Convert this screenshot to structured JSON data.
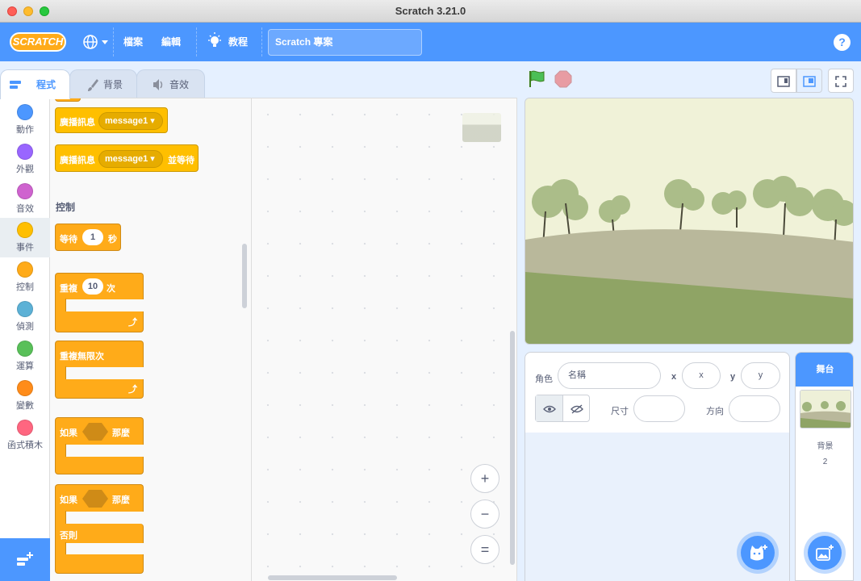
{
  "window": {
    "title": "Scratch 3.21.0"
  },
  "menu": {
    "logo": "SCRATCH",
    "file": "檔案",
    "edit": "編輯",
    "tutorials": "教程",
    "project_title": "Scratch 專案",
    "help": "?"
  },
  "tabs": [
    {
      "label": "程式"
    },
    {
      "label": "背景"
    },
    {
      "label": "音效"
    }
  ],
  "categories": [
    {
      "label": "動作",
      "color": "#4c97ff"
    },
    {
      "label": "外觀",
      "color": "#9966ff"
    },
    {
      "label": "音效",
      "color": "#cf63cf"
    },
    {
      "label": "事件",
      "color": "#ffbf00"
    },
    {
      "label": "控制",
      "color": "#ffab19"
    },
    {
      "label": "偵測",
      "color": "#5cb1d6"
    },
    {
      "label": "運算",
      "color": "#59c059"
    },
    {
      "label": "變數",
      "color": "#ff8c1a"
    },
    {
      "label": "函式積木",
      "color": "#ff6680"
    }
  ],
  "blocks": {
    "broadcast": {
      "label": "廣播訊息",
      "message": "message1"
    },
    "broadcast_wait": {
      "label": "廣播訊息",
      "message": "message1",
      "suffix": "並等待"
    },
    "section_control": "控制",
    "wait": {
      "label": "等待",
      "value": "1",
      "unit": "秒"
    },
    "repeat": {
      "label": "重複",
      "value": "10",
      "unit": "次"
    },
    "forever": {
      "label": "重複無限次"
    },
    "if_then": {
      "if": "如果",
      "then": "那麼"
    },
    "if_else": {
      "if": "如果",
      "then": "那麼",
      "else": "否則"
    }
  },
  "zoom": {
    "in": "+",
    "out": "−",
    "reset": "="
  },
  "sprite_info": {
    "sprite_label": "角色",
    "name_placeholder": "名稱",
    "x_label": "x",
    "x_placeholder": "x",
    "y_label": "y",
    "y_placeholder": "y",
    "size_label": "尺寸",
    "direction_label": "方向"
  },
  "stage_pane": {
    "title": "舞台",
    "backdrops_label": "背景",
    "backdrops_count": "2"
  },
  "colors": {
    "menu_blue": "#4c97ff",
    "control_orange": "#ffab19",
    "events_yellow": "#ffbf00"
  }
}
